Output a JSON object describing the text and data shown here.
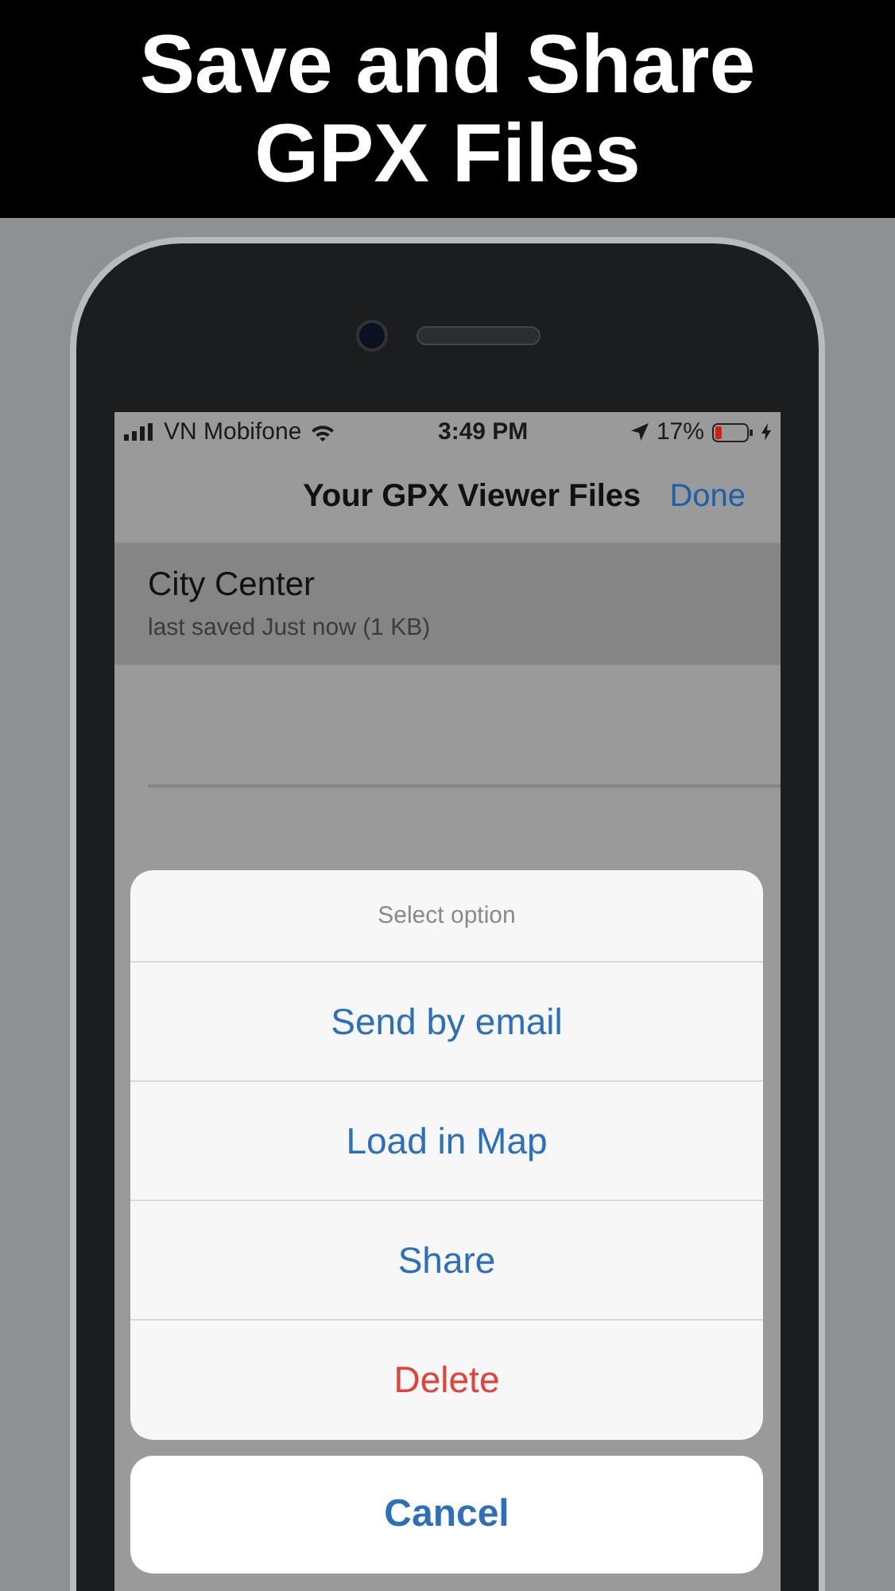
{
  "headline": "Save and Share\nGPX Files",
  "status_bar": {
    "carrier": "VN Mobifone",
    "time": "3:49 PM",
    "battery": "17%"
  },
  "nav": {
    "title": "Your GPX Viewer Files",
    "action": "Done"
  },
  "files": [
    {
      "name": "City Center",
      "detail": "last saved Just now (1 KB)",
      "selected": true
    }
  ],
  "action_sheet": {
    "title": "Select option",
    "options": [
      {
        "label": "Send by email",
        "kind": "default"
      },
      {
        "label": "Load in Map",
        "kind": "default"
      },
      {
        "label": "Share",
        "kind": "default"
      },
      {
        "label": "Delete",
        "kind": "destructive"
      }
    ],
    "cancel": "Cancel"
  }
}
